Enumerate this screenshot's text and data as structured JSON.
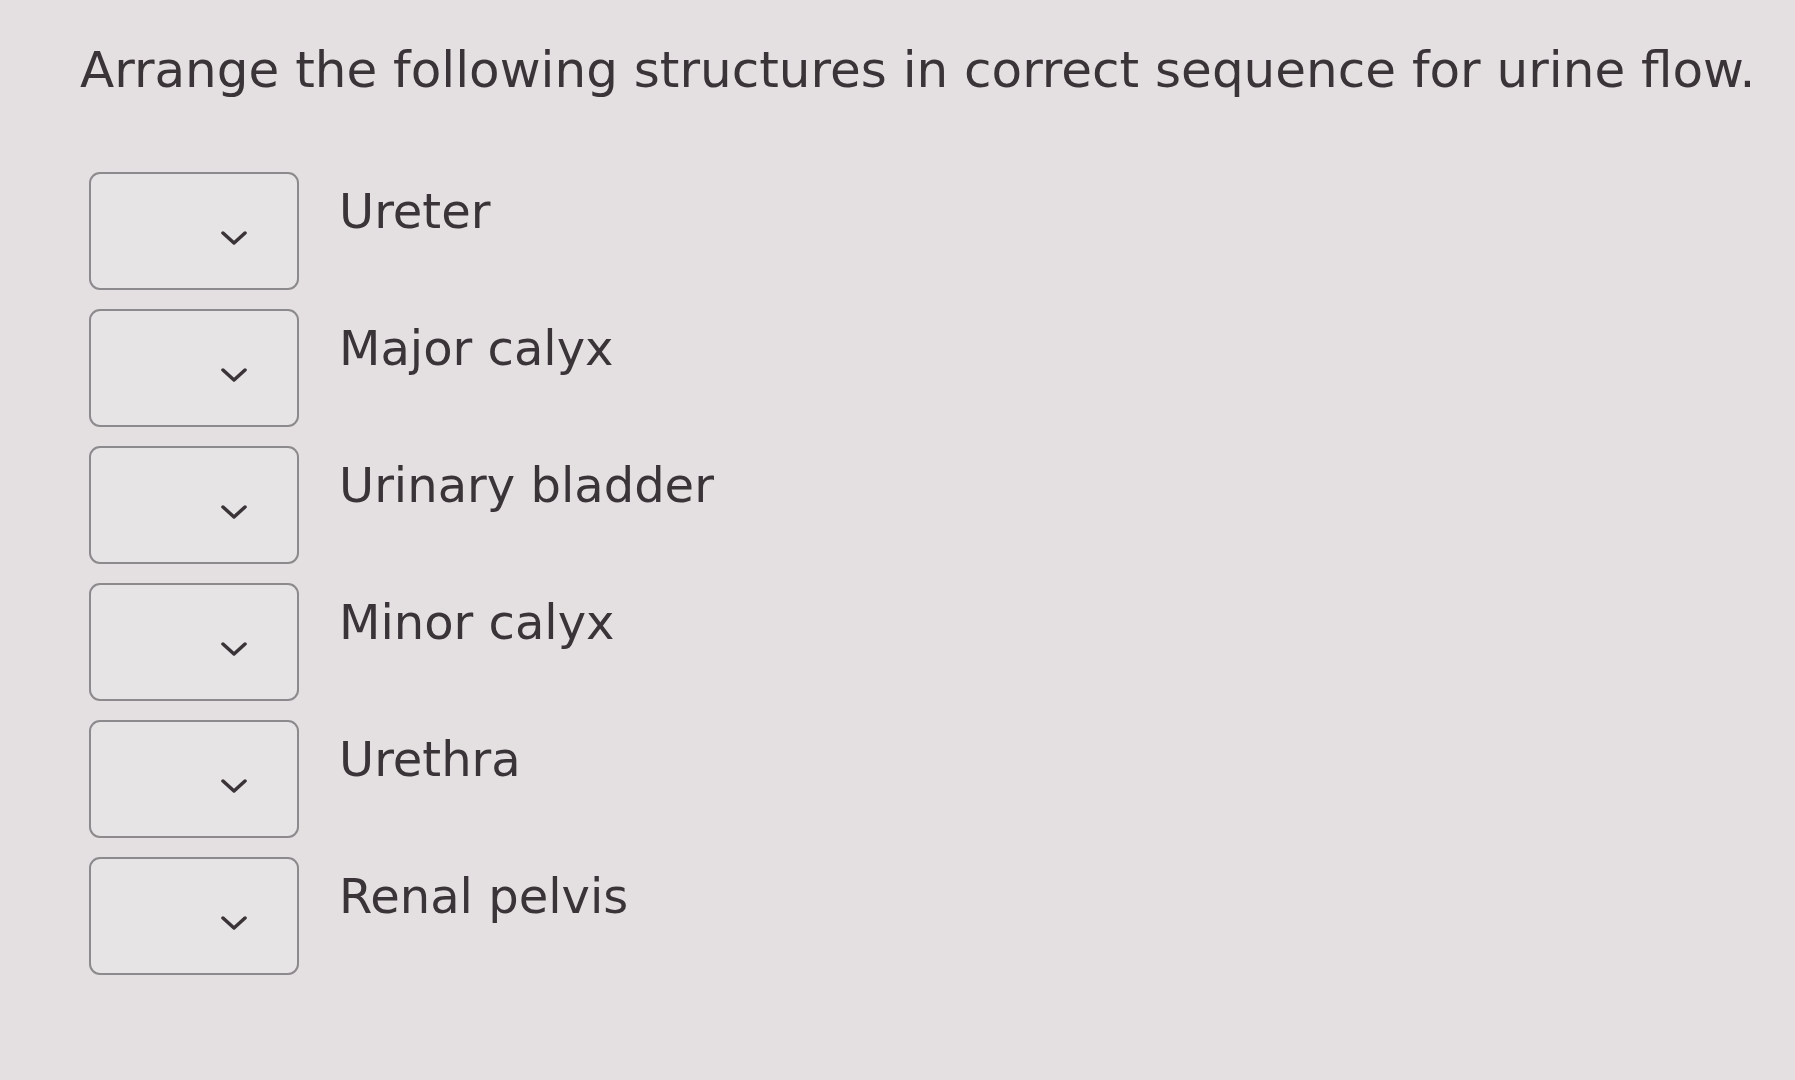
{
  "question": "Arrange the following structures in correct sequence for urine flow.",
  "items": [
    {
      "label": "Ureter"
    },
    {
      "label": "Major calyx"
    },
    {
      "label": "Urinary bladder"
    },
    {
      "label": "Minor calyx"
    },
    {
      "label": "Urethra"
    },
    {
      "label": "Renal pelvis"
    }
  ]
}
